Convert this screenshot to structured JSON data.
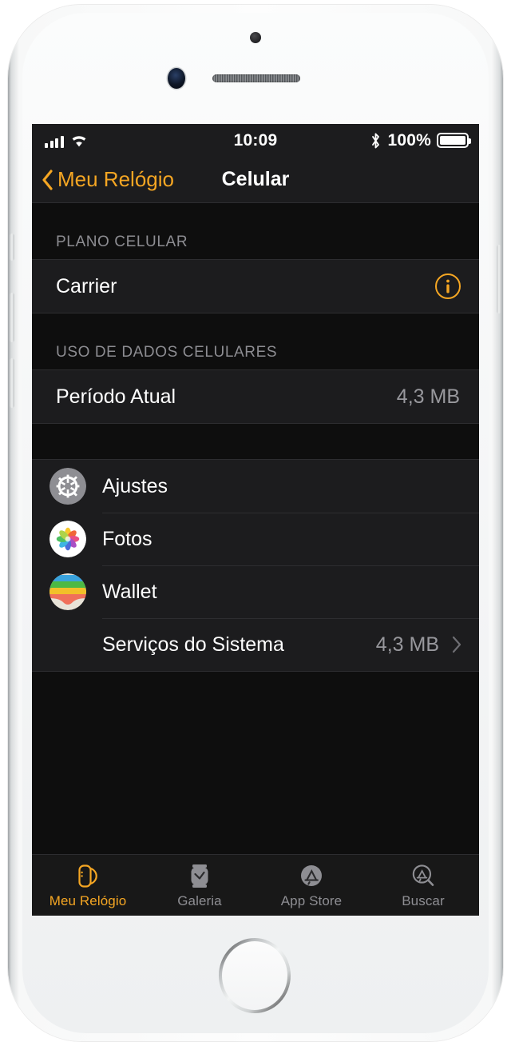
{
  "device": {
    "name": "iphone-silver",
    "sensor": "proximity-sensor",
    "camera": "front-camera",
    "earpiece": "earpiece-speaker",
    "home": "home-button"
  },
  "status_bar": {
    "signal_icon": "cellular-signal-icon",
    "signal_bars": 4,
    "wifi_icon": "wifi-icon",
    "time": "10:09",
    "bluetooth_icon": "bluetooth-icon",
    "battery_percent": "100%",
    "battery_level": 100,
    "battery_icon": "battery-full-icon"
  },
  "nav_bar": {
    "back_icon": "chevron-left-icon",
    "back_label": "Meu Relógio",
    "title": "Celular"
  },
  "sections": [
    {
      "header": "PLANO CELULAR",
      "rows": [
        {
          "title": "Carrier",
          "value": "",
          "accessory": "info-icon"
        }
      ]
    },
    {
      "header": "USO DE DADOS CELULARES",
      "rows": [
        {
          "title": "Período Atual",
          "value": "4,3 MB",
          "accessory": "none"
        }
      ]
    },
    {
      "header": "",
      "rows": [
        {
          "title": "Ajustes",
          "value": "",
          "accessory": "none",
          "icon": "settings-app-icon"
        },
        {
          "title": "Fotos",
          "value": "",
          "accessory": "none",
          "icon": "photos-app-icon"
        },
        {
          "title": "Wallet",
          "value": "",
          "accessory": "none",
          "icon": "wallet-app-icon"
        },
        {
          "title": "Serviços do Sistema",
          "value": "4,3 MB",
          "accessory": "chevron-right-icon"
        }
      ]
    }
  ],
  "tab_bar": {
    "items": [
      {
        "label": "Meu Relógio",
        "icon": "watch-outline-icon",
        "active": true
      },
      {
        "label": "Galeria",
        "icon": "watch-face-gallery-icon",
        "active": false
      },
      {
        "label": "App Store",
        "icon": "app-store-icon",
        "active": false
      },
      {
        "label": "Buscar",
        "icon": "app-store-search-icon",
        "active": false
      }
    ]
  },
  "colors": {
    "accent": "#f5a623",
    "screen_bg": "#0e0e0e",
    "cell_bg": "#1c1c1e",
    "separator": "#2d2d30",
    "secondary_text": "#98989d",
    "tab_inactive": "#8e8e93"
  }
}
